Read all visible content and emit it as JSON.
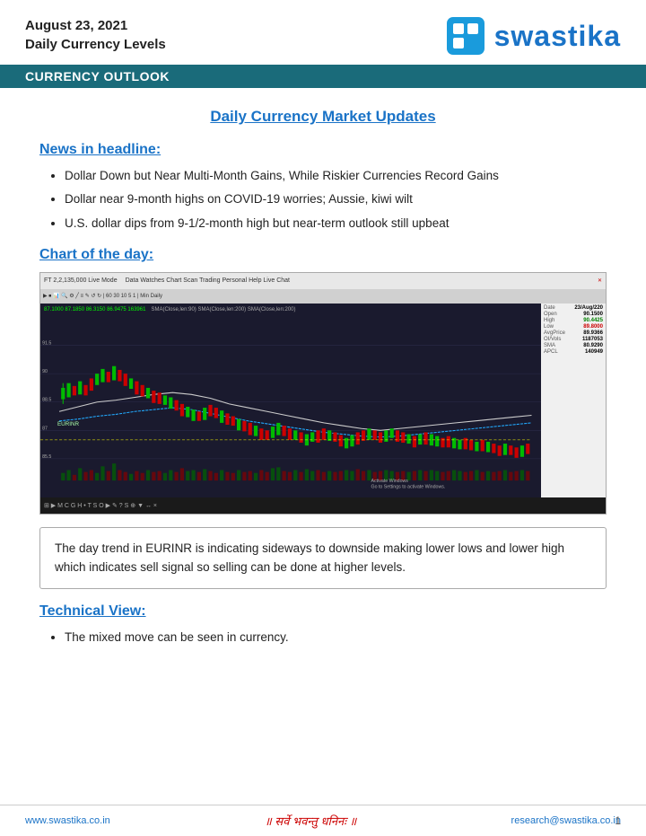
{
  "header": {
    "date_line1": "August 23, 2021",
    "date_line2": "Daily Currency Levels",
    "logo_text": "swastika",
    "logo_icon": "swastika-logo"
  },
  "banner": {
    "label": "CURRENCY OUTLOOK"
  },
  "main": {
    "page_title": "Daily Currency Market Updates",
    "news_section": {
      "title": "News in headline:",
      "items": [
        "Dollar Down but Near Multi-Month Gains, While Riskier Currencies Record Gains",
        "Dollar near 9-month highs on COVID-19 worries; Aussie, kiwi wilt",
        "U.S. dollar dips from 9-1/2-month high but near-term outlook still upbeat"
      ]
    },
    "chart_section": {
      "title": "Chart of the day:",
      "toolbar_text": "FT 2,2,135,000 Live Mode",
      "sidebar": {
        "date_val": "23/Aug/220",
        "open_val": "90.1500",
        "high_val": "90.4425",
        "low_val": "89.8000",
        "avgprice_val": "89.9366",
        "oi_val": "1187053",
        "sma_val": "80.9290",
        "apcl_val": "140949"
      }
    },
    "info_box": "The day trend in EURINR is indicating sideways to downside making lower lows and lower high which indicates sell signal so selling can be done at higher levels.",
    "technical_section": {
      "title": "Technical View:",
      "items": [
        "The mixed move can be seen in currency."
      ]
    }
  },
  "footer": {
    "left": "www.swastika.co.in",
    "center": "॥ सर्वे भवन्तु धनिनः ॥",
    "right": "research@swastika.co.in",
    "page_number": "1"
  }
}
